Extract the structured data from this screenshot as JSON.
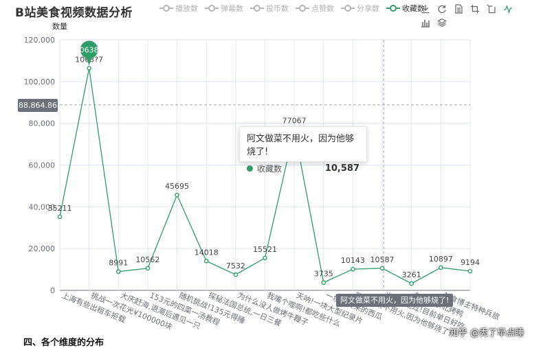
{
  "title": "B站美食视频数据分析",
  "legend": [
    {
      "label": "播放数",
      "active": false
    },
    {
      "label": "弹幕数",
      "active": false
    },
    {
      "label": "投币数",
      "active": false
    },
    {
      "label": "点赞数",
      "active": false
    },
    {
      "label": "分享数",
      "active": false
    },
    {
      "label": "收藏数",
      "active": true
    }
  ],
  "toolbox": [
    "download-icon",
    "refresh-icon",
    "data-view-icon",
    "zoom-icon",
    "zoom-reset-icon",
    "line-chart-icon",
    "bar-chart-icon",
    "stack-icon"
  ],
  "colors": {
    "series": "#2e9d6a",
    "marker": "#2e9d6a",
    "crosshair": "#6e7079"
  },
  "chart_data": {
    "type": "line",
    "ylabel": "数量",
    "ylim": [
      0,
      120000
    ],
    "yticks": [
      "0",
      "20,000",
      "40,000",
      "60,000",
      "80,000",
      "100,000",
      "120,000"
    ],
    "categories": [
      "上海有些出租车拒载",
      "挑战一次花光¥100000块",
      "大庆赶海,退潮后遇见一只",
      "153元的四菜一汤教程",
      "随机挑战!135元得睡",
      "探秘法国总统,一日三餐",
      "为什么没人做烤牛鞭子",
      "我嘴个噬啊!都吃些什么",
      "天呐!一块大型纪录片",
      "一块钱买来的西瓜",
      "阿文做菜不用火,因为他够烧了!",
      "谁还没吃过!目前单日好吃",
      "怎么做东北烤鸭",
      "美食博主特种兵旅"
    ],
    "series": [
      {
        "values": [
          35211,
          106387,
          8991,
          10562,
          45695,
          14018,
          7532,
          15521,
          77067,
          3735,
          10143,
          10587,
          3261,
          10897,
          9194
        ]
      }
    ],
    "point_labels": [
      "35211",
      "1063?7",
      "8991",
      "10562",
      "45695",
      "14018",
      "7532",
      "15521",
      "77067",
      "3735",
      "10143",
      "10587",
      "3261",
      "10897",
      "9194"
    ],
    "max_marker_label": "0638",
    "hover_index": 11,
    "tooltip": {
      "title": "阿文做菜不用火，因为他够烧了!",
      "series_name": "收藏数",
      "value": "10,587"
    },
    "crosshair_y_label": "88,864.86",
    "crosshair_y_value": 88864.86,
    "crosshair_x_label": "阿文做菜不用火，因为他够烧了!"
  },
  "watermark": "知乎 @秃了早点睡",
  "bottom_heading": "四、各个维度的分布"
}
